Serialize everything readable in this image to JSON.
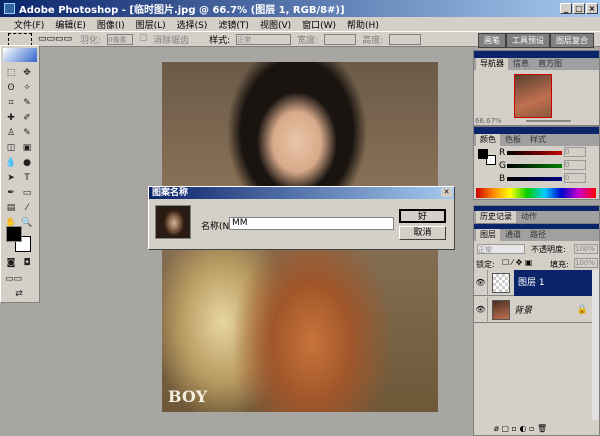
{
  "window": {
    "title": "Adobe Photoshop - [临时图片.jpg @ 66.7% (图层 1, RGB/8#)]",
    "min": "_",
    "max": "□",
    "close": "×"
  },
  "menu": [
    "文件(F)",
    "编辑(E)",
    "图像(I)",
    "图层(L)",
    "选择(S)",
    "滤镜(T)",
    "视图(V)",
    "窗口(W)",
    "帮助(H)"
  ],
  "options": {
    "feather": "羽化:",
    "feather_value": "0像素",
    "antialias": "消除锯齿",
    "style_label": "样式:",
    "style_value": "正常",
    "width": "宽度:",
    "height": "高度:",
    "palette_tabs": [
      "画笔",
      "工具预设",
      "图层复合"
    ]
  },
  "canvas": {
    "logo": "BOY"
  },
  "dialog": {
    "title": "图案名称",
    "name_label": "名称(N):",
    "name_value": "MM",
    "ok": "好",
    "cancel": "取消"
  },
  "navigator": {
    "tabs": [
      "导航器",
      "信息",
      "直方图"
    ],
    "zoom": "66.67%"
  },
  "color": {
    "tabs": [
      "颜色",
      "色板",
      "样式"
    ],
    "channels": [
      {
        "label": "R",
        "value": "0",
        "color": "#c00000"
      },
      {
        "label": "G",
        "value": "0",
        "color": "#008000"
      },
      {
        "label": "B",
        "value": "0",
        "color": "#000080"
      }
    ]
  },
  "history": {
    "tabs": [
      "历史记录",
      "动作"
    ]
  },
  "layers": {
    "tabs": [
      "图层",
      "通道",
      "路径"
    ],
    "blend": "正常",
    "opacity_label": "不透明度:",
    "opacity": "100%",
    "lock_label": "锁定:",
    "fill_label": "填充:",
    "fill": "100%",
    "items": [
      {
        "name": "图层 1",
        "selected": true
      },
      {
        "name": "背景",
        "selected": false
      }
    ]
  }
}
